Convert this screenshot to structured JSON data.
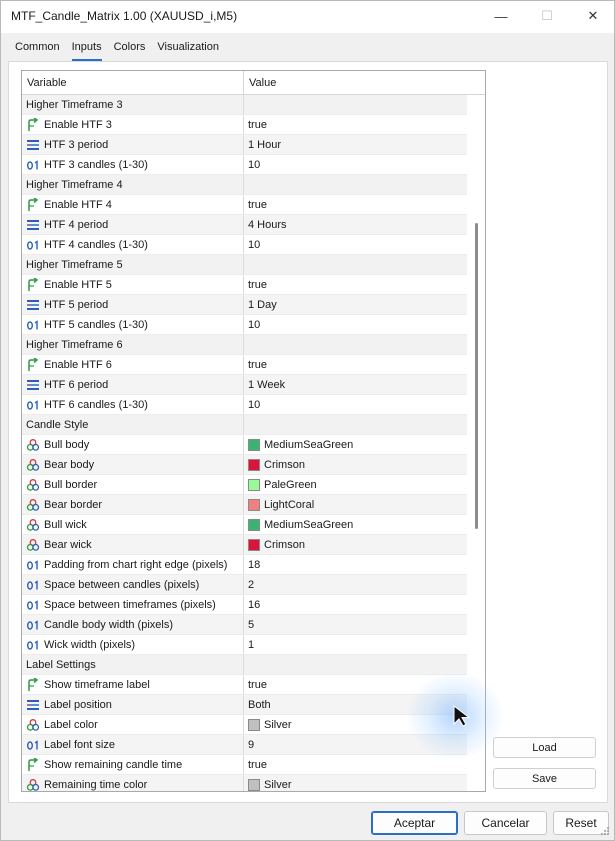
{
  "window": {
    "title": "MTF_Candle_Matrix 1.00 (XAUUSD_i,M5)",
    "controls": {
      "minimize": "—",
      "maximize": "☐",
      "close": "✕"
    }
  },
  "tabs": [
    {
      "label": "Common",
      "active": false
    },
    {
      "label": "Inputs",
      "active": true
    },
    {
      "label": "Colors",
      "active": false
    },
    {
      "label": "Visualization",
      "active": false
    }
  ],
  "grid": {
    "header": {
      "variable": "Variable",
      "value": "Value"
    },
    "rows": [
      {
        "kind": "group",
        "label": "Higher Timeframe 3",
        "value": ""
      },
      {
        "kind": "bool",
        "label": "Enable HTF 3",
        "value": "true"
      },
      {
        "kind": "enum",
        "label": "HTF 3 period",
        "value": "1 Hour"
      },
      {
        "kind": "int",
        "label": "HTF 3 candles (1-30)",
        "value": "10"
      },
      {
        "kind": "group",
        "label": "Higher Timeframe 4",
        "value": ""
      },
      {
        "kind": "bool",
        "label": "Enable HTF 4",
        "value": "true"
      },
      {
        "kind": "enum",
        "label": "HTF 4 period",
        "value": "4 Hours"
      },
      {
        "kind": "int",
        "label": "HTF 4 candles (1-30)",
        "value": "10"
      },
      {
        "kind": "group",
        "label": "Higher Timeframe 5",
        "value": ""
      },
      {
        "kind": "bool",
        "label": "Enable HTF 5",
        "value": "true"
      },
      {
        "kind": "enum",
        "label": "HTF 5 period",
        "value": "1 Day"
      },
      {
        "kind": "int",
        "label": "HTF 5 candles (1-30)",
        "value": "10"
      },
      {
        "kind": "group",
        "label": "Higher Timeframe 6",
        "value": ""
      },
      {
        "kind": "bool",
        "label": "Enable HTF 6",
        "value": "true"
      },
      {
        "kind": "enum",
        "label": "HTF 6 period",
        "value": "1 Week"
      },
      {
        "kind": "int",
        "label": "HTF 6 candles (1-30)",
        "value": "10"
      },
      {
        "kind": "group",
        "label": "Candle Style",
        "value": ""
      },
      {
        "kind": "color",
        "label": "Bull body",
        "value": "MediumSeaGreen",
        "color": "#3cb371"
      },
      {
        "kind": "color",
        "label": "Bear body",
        "value": "Crimson",
        "color": "#dc143c"
      },
      {
        "kind": "color",
        "label": "Bull border",
        "value": "PaleGreen",
        "color": "#98fb98"
      },
      {
        "kind": "color",
        "label": "Bear border",
        "value": "LightCoral",
        "color": "#f08080"
      },
      {
        "kind": "color",
        "label": "Bull wick",
        "value": "MediumSeaGreen",
        "color": "#3cb371"
      },
      {
        "kind": "color",
        "label": "Bear wick",
        "value": "Crimson",
        "color": "#dc143c"
      },
      {
        "kind": "int",
        "label": "Padding from chart right edge (pixels)",
        "value": "18"
      },
      {
        "kind": "int",
        "label": "Space between candles (pixels)",
        "value": "2"
      },
      {
        "kind": "int",
        "label": "Space between timeframes (pixels)",
        "value": "16"
      },
      {
        "kind": "int",
        "label": "Candle body width (pixels)",
        "value": "5"
      },
      {
        "kind": "int",
        "label": "Wick width (pixels)",
        "value": "1"
      },
      {
        "kind": "group",
        "label": "Label Settings",
        "value": ""
      },
      {
        "kind": "bool",
        "label": "Show timeframe label",
        "value": "true"
      },
      {
        "kind": "enum",
        "label": "Label position",
        "value": "Both"
      },
      {
        "kind": "color",
        "label": "Label color",
        "value": "Silver",
        "color": "#c0c0c0"
      },
      {
        "kind": "int",
        "label": "Label font size",
        "value": "9"
      },
      {
        "kind": "bool",
        "label": "Show remaining candle time",
        "value": "true"
      },
      {
        "kind": "color",
        "label": "Remaining time color",
        "value": "Silver",
        "color": "#c0c0c0"
      }
    ]
  },
  "side_buttons": {
    "load": "Load",
    "save": "Save"
  },
  "footer_buttons": {
    "ok": "Aceptar",
    "cancel": "Cancelar",
    "reset": "Reset"
  },
  "icon_names": {
    "bool": "bool-arrow-icon",
    "enum": "enum-list-icon",
    "int": "integer-icon",
    "color": "color-palette-icon"
  },
  "colors": {
    "accent": "#2b6fc2",
    "bool_icon": "#2e9a3f",
    "enum_icon": "#2b5fb8",
    "int_icon": "#2b5fb8"
  }
}
